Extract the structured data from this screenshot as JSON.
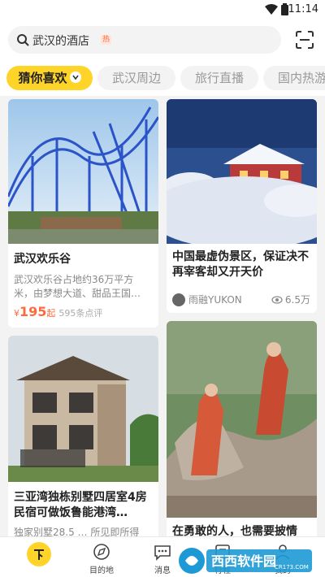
{
  "status": {
    "time": "11:14"
  },
  "search": {
    "query": "武汉的酒店",
    "badge": "热"
  },
  "tabs": [
    {
      "label": "猜你喜欢"
    },
    {
      "label": "武汉周边"
    },
    {
      "label": "旅行直播"
    },
    {
      "label": "国内热游"
    }
  ],
  "cards": [
    {
      "title": "武汉欢乐谷",
      "desc": "武汉欢乐谷占地约36万平方米，由梦想大道、甜品王国…",
      "currency": "¥",
      "price": "195",
      "price_suffix": "起",
      "reviews": "595条点评"
    },
    {
      "title": "中国最虚伪景区，保证决不再宰客却又开天价",
      "author": "雨融YUKON",
      "views": "6.5万"
    },
    {
      "title": "三亚湾独栋别墅四居室4房民宿可做饭鲁能港湾…",
      "desc": "独家别墅28.5 … 所见即所得"
    },
    {
      "title": "在勇敢的人，也需要披情"
    }
  ],
  "nav": [
    {
      "label": ""
    },
    {
      "label": "目的地"
    },
    {
      "label": "消息"
    },
    {
      "label": "行程"
    },
    {
      "label": "我的"
    }
  ],
  "watermark": {
    "text": "西西软件园",
    "sub": "CR173.COM"
  },
  "colors": {
    "accent": "#ffd428",
    "price": "#ff6a3d"
  }
}
